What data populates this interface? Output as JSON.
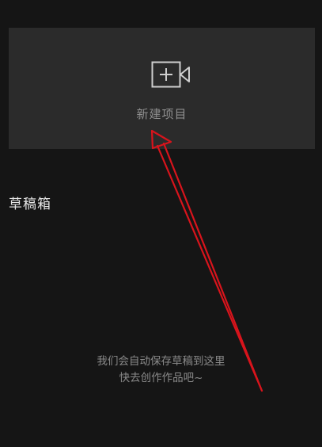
{
  "new_project": {
    "icon": "video-add-icon",
    "label": "新建项目"
  },
  "drafts": {
    "title": "草稿箱",
    "empty_hint_line1": "我们会自动保存草稿到这里",
    "empty_hint_line2": "快去创作作品吧~"
  },
  "annotation": {
    "icon": "red-arrow-icon",
    "color": "#d8141c"
  },
  "colors": {
    "background": "#151515",
    "card": "#2b2b2b",
    "muted_text": "#8f8f8f"
  }
}
